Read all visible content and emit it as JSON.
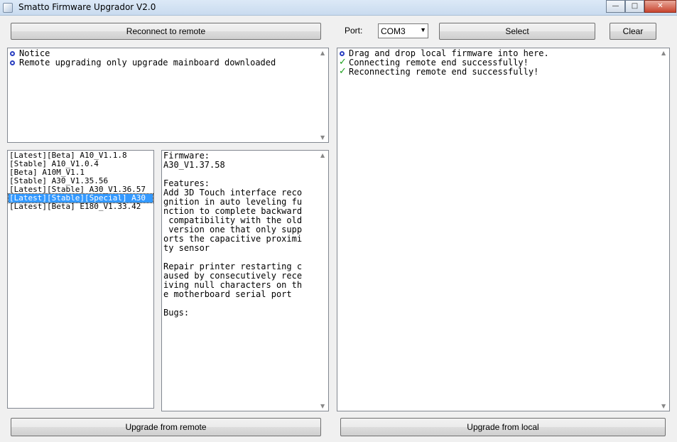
{
  "window": {
    "title": "Smatto Firmware Upgrador V2.0",
    "min": "—",
    "max": "□",
    "close": "✕"
  },
  "toolbar": {
    "reconnect_label": "Reconnect to remote",
    "port_label": "Port:",
    "port_value": "COM3",
    "select_label": "Select",
    "clear_label": "Clear"
  },
  "notice_log": [
    {
      "icon": "info-bullet-icon",
      "text": "Notice"
    },
    {
      "icon": "info-bullet-icon",
      "text": "Remote upgrading only upgrade mainboard downloaded"
    }
  ],
  "firmware_list": [
    "[Latest][Beta] A10_V1.1.8",
    "[Stable] A10_V1.0.4",
    "[Beta] A10M_V1.1",
    "[Stable] A30_V1.35.56",
    "[Latest][Stable] A30_V1.36.57",
    "[Latest][Stable][Special] A30",
    "[Latest][Beta] E180_V1.33.42"
  ],
  "selected_firmware_index": 5,
  "details_text": "Firmware:\nA30_V1.37.58\n\nFeatures:\nAdd 3D Touch interface reco\ngnition in auto leveling fu\nnction to complete backward\n compatibility with the old\n version one that only supp\norts the capacitive proximi\nty sensor\n\nRepair printer restarting c\naused by consecutively rece\niving null characters on th\ne motherboard serial port\n\nBugs:",
  "status_log": [
    {
      "icon": "info-bullet-icon",
      "text": "Drag and drop local firmware into here."
    },
    {
      "icon": "check-icon",
      "text": "Connecting remote end successfully!"
    },
    {
      "icon": "check-icon",
      "text": "Reconnecting remote end successfully!"
    }
  ],
  "footer": {
    "upgrade_remote_label": "Upgrade from remote",
    "upgrade_local_label": "Upgrade from local"
  },
  "colors": {
    "selection": "#3399ff",
    "bullet": "#2a3fc0",
    "check": "#1ea01e"
  }
}
